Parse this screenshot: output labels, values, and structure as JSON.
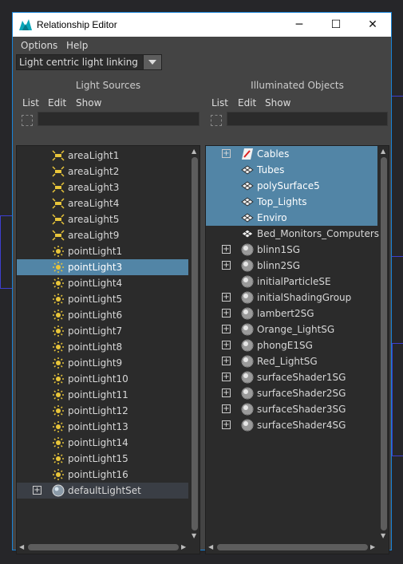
{
  "window": {
    "title": "Relationship Editor",
    "minimize_glyph": "─",
    "maximize_glyph": "☐",
    "close_glyph": "✕"
  },
  "menubar": {
    "items": [
      "Options",
      "Help"
    ]
  },
  "mode_dropdown": {
    "value": "Light centric light linking"
  },
  "left_panel": {
    "title": "Light Sources",
    "menu": [
      "List",
      "Edit",
      "Show"
    ],
    "filter_value": "",
    "items": [
      {
        "label": "areaLight1",
        "icon": "area-light-icon",
        "selected": false
      },
      {
        "label": "areaLight2",
        "icon": "area-light-icon",
        "selected": false
      },
      {
        "label": "areaLight3",
        "icon": "area-light-icon",
        "selected": false
      },
      {
        "label": "areaLight4",
        "icon": "area-light-icon",
        "selected": false
      },
      {
        "label": "areaLight5",
        "icon": "area-light-icon",
        "selected": false
      },
      {
        "label": "areaLight9",
        "icon": "area-light-icon",
        "selected": false
      },
      {
        "label": "pointLight1",
        "icon": "point-light-icon",
        "selected": false
      },
      {
        "label": "pointLight3",
        "icon": "point-light-icon",
        "selected": true
      },
      {
        "label": "pointLight4",
        "icon": "point-light-icon",
        "selected": false
      },
      {
        "label": "pointLight5",
        "icon": "point-light-icon",
        "selected": false
      },
      {
        "label": "pointLight6",
        "icon": "point-light-icon",
        "selected": false
      },
      {
        "label": "pointLight7",
        "icon": "point-light-icon",
        "selected": false
      },
      {
        "label": "pointLight8",
        "icon": "point-light-icon",
        "selected": false
      },
      {
        "label": "pointLight9",
        "icon": "point-light-icon",
        "selected": false
      },
      {
        "label": "pointLight10",
        "icon": "point-light-icon",
        "selected": false
      },
      {
        "label": "pointLight11",
        "icon": "point-light-icon",
        "selected": false
      },
      {
        "label": "pointLight12",
        "icon": "point-light-icon",
        "selected": false
      },
      {
        "label": "pointLight13",
        "icon": "point-light-icon",
        "selected": false
      },
      {
        "label": "pointLight14",
        "icon": "point-light-icon",
        "selected": false
      },
      {
        "label": "pointLight15",
        "icon": "point-light-icon",
        "selected": false
      },
      {
        "label": "pointLight16",
        "icon": "point-light-icon",
        "selected": false
      },
      {
        "label": "defaultLightSet",
        "icon": "light-set-icon",
        "selected": false,
        "expandable": true
      }
    ]
  },
  "right_panel": {
    "title": "Illuminated Objects",
    "menu": [
      "List",
      "Edit",
      "Show"
    ],
    "filter_value": "",
    "items": [
      {
        "label": "Cables",
        "icon": "set-icon",
        "expandable": true,
        "selected": true
      },
      {
        "label": "Tubes",
        "icon": "mesh-icon",
        "expandable": false,
        "selected": true
      },
      {
        "label": "polySurface5",
        "icon": "mesh-icon",
        "expandable": false,
        "selected": true
      },
      {
        "label": "Top_Lights",
        "icon": "mesh-icon",
        "expandable": false,
        "selected": true
      },
      {
        "label": "Enviro",
        "icon": "mesh-icon",
        "expandable": false,
        "selected": true
      },
      {
        "label": "Bed_Monitors_Computerstand",
        "icon": "mesh-icon",
        "expandable": false,
        "selected": false
      },
      {
        "label": "blinn1SG",
        "icon": "shading-group-icon",
        "expandable": true,
        "selected": false
      },
      {
        "label": "blinn2SG",
        "icon": "shading-group-icon",
        "expandable": true,
        "selected": false
      },
      {
        "label": "initialParticleSE",
        "icon": "shading-group-icon",
        "expandable": false,
        "selected": false
      },
      {
        "label": "initialShadingGroup",
        "icon": "shading-group-icon",
        "expandable": true,
        "selected": false
      },
      {
        "label": "lambert2SG",
        "icon": "shading-group-icon",
        "expandable": true,
        "selected": false
      },
      {
        "label": "Orange_LightSG",
        "icon": "shading-group-icon",
        "expandable": true,
        "selected": false
      },
      {
        "label": "phongE1SG",
        "icon": "shading-group-icon",
        "expandable": true,
        "selected": false
      },
      {
        "label": "Red_LightSG",
        "icon": "shading-group-icon",
        "expandable": true,
        "selected": false
      },
      {
        "label": "surfaceShader1SG",
        "icon": "shading-group-icon",
        "expandable": true,
        "selected": false
      },
      {
        "label": "surfaceShader2SG",
        "icon": "shading-group-icon",
        "expandable": true,
        "selected": false
      },
      {
        "label": "surfaceShader3SG",
        "icon": "shading-group-icon",
        "expandable": true,
        "selected": false
      },
      {
        "label": "surfaceShader4SG",
        "icon": "shading-group-icon",
        "expandable": true,
        "selected": false
      }
    ]
  },
  "colors": {
    "selection": "#5285a6",
    "list_bg": "#2b2b2b",
    "panel_bg": "#444444",
    "light_icon": "#e8c53a",
    "window_border": "#1883d7"
  }
}
